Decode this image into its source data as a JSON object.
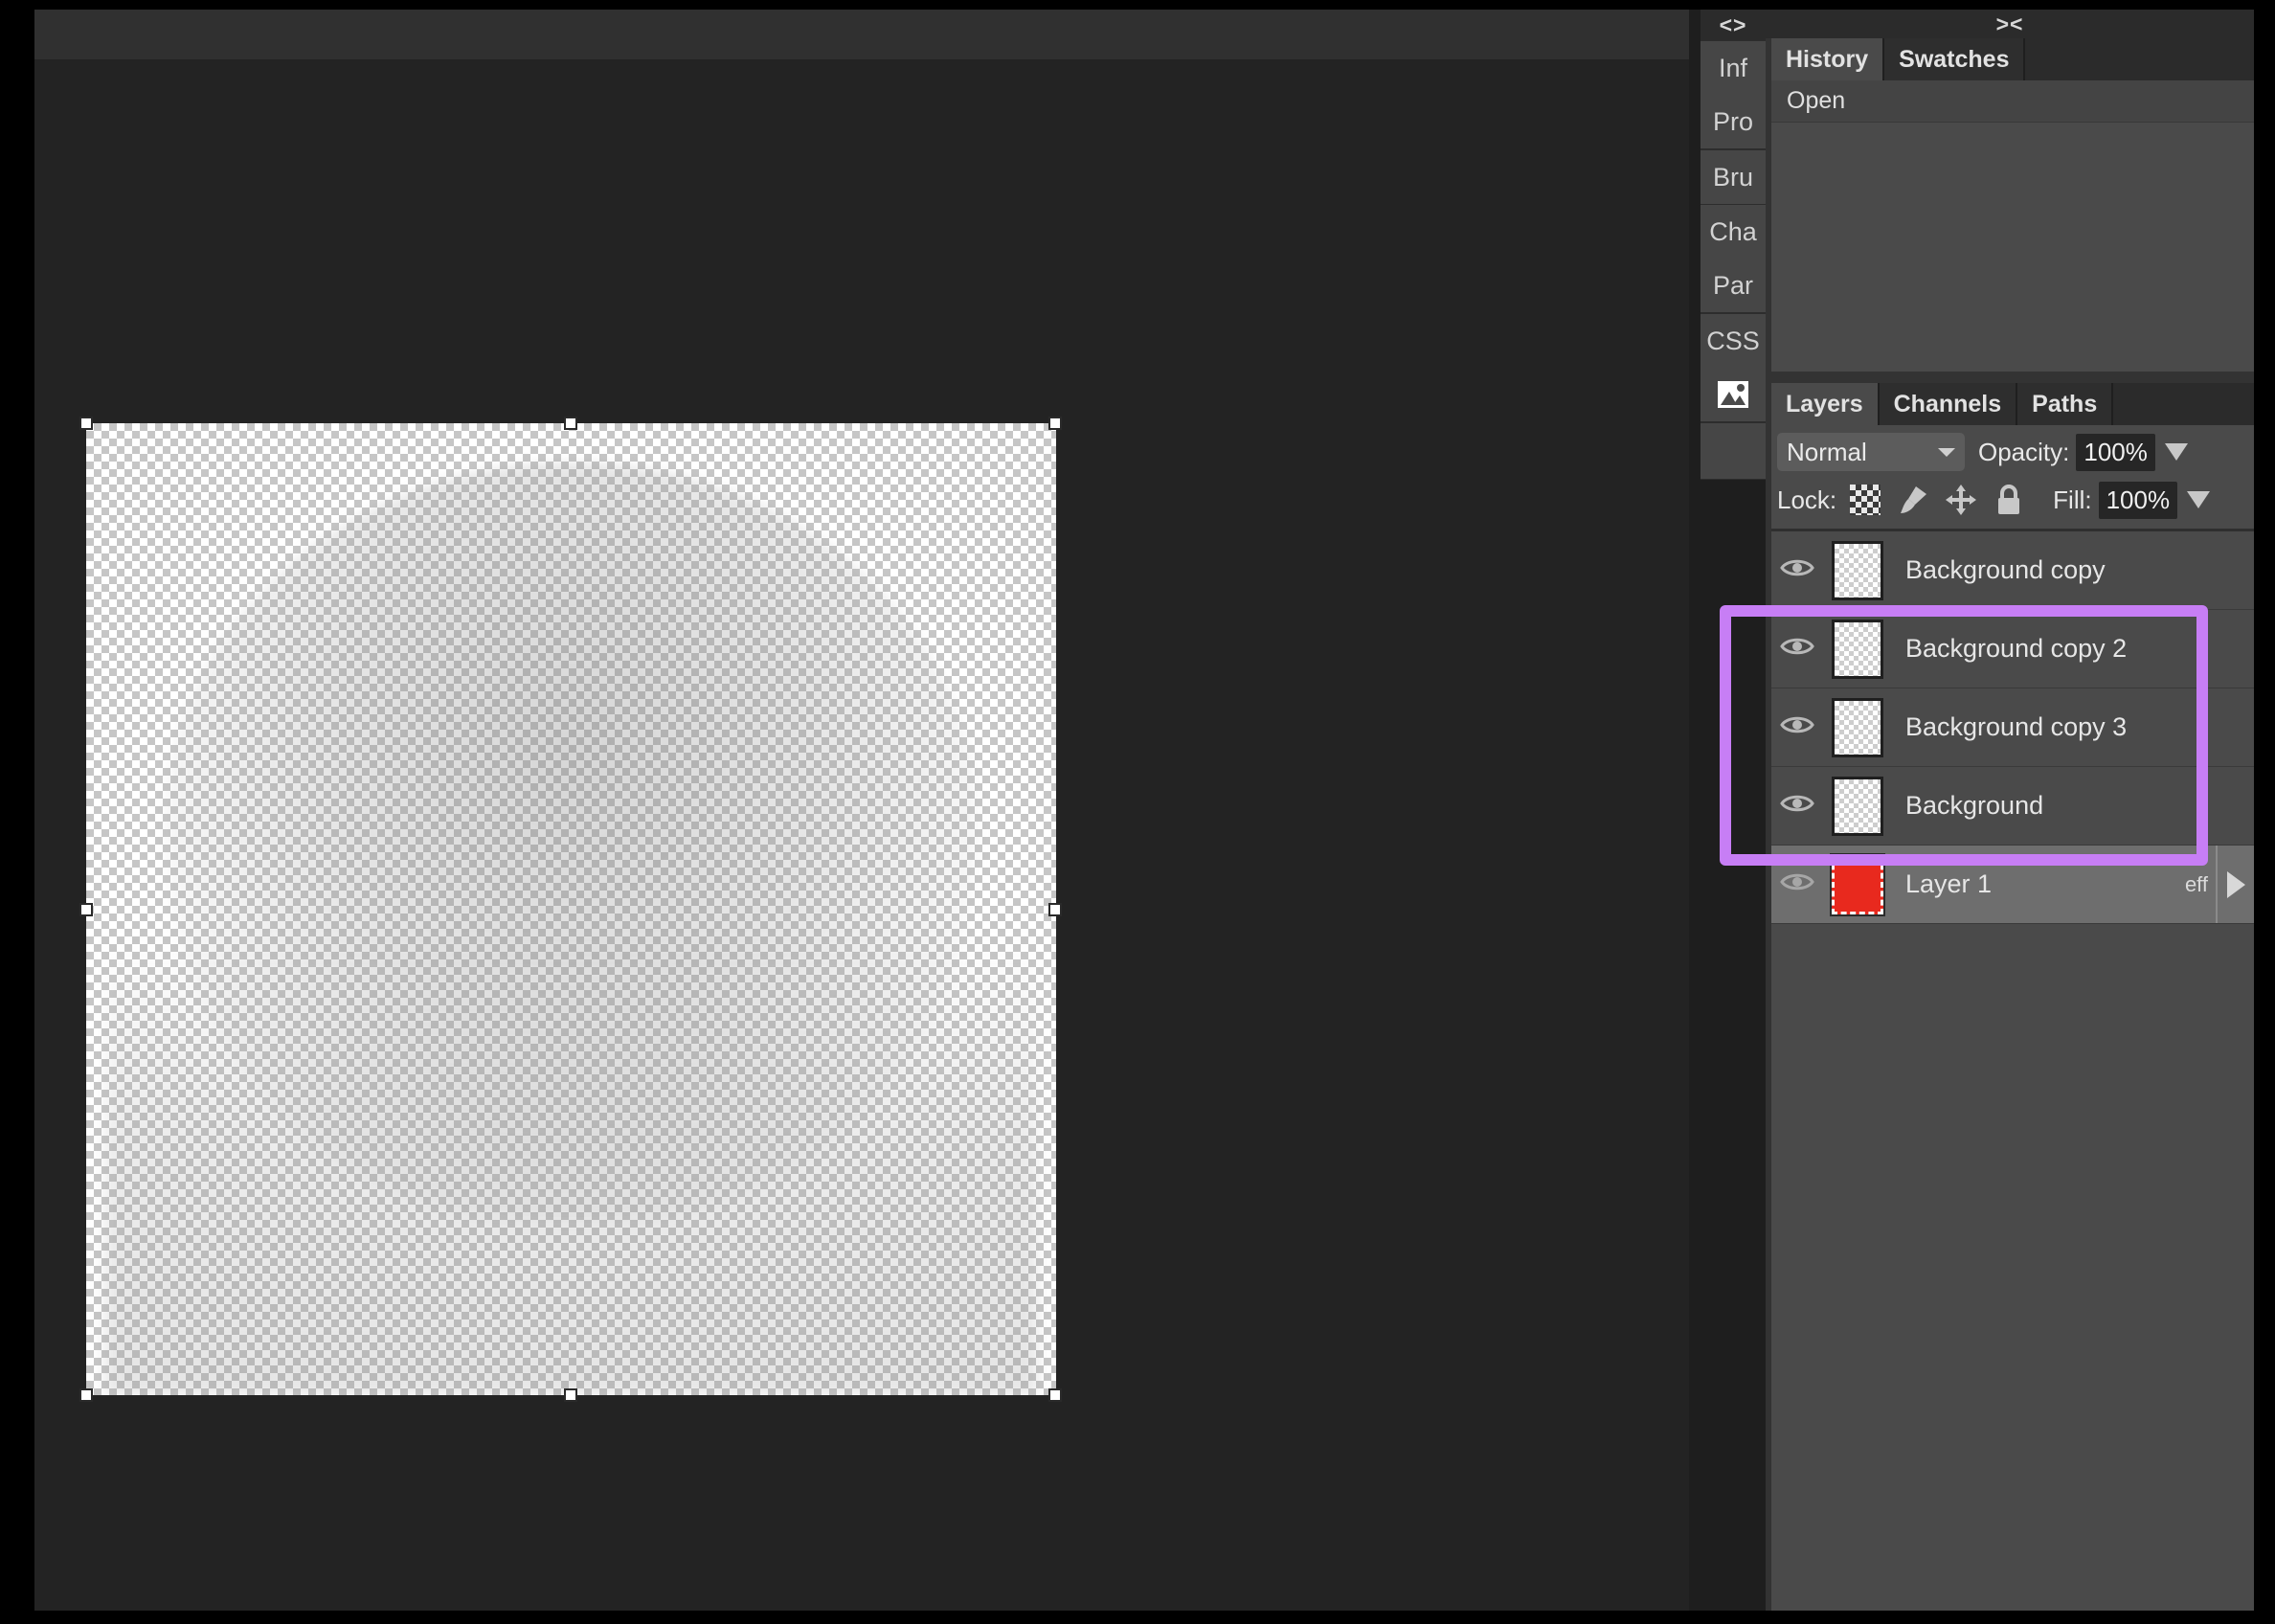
{
  "app": {
    "title": "Photopea Image Editor",
    "canvas_bg": "#232323",
    "panel_bg": "#4a4a4a",
    "accent_highlight": "#c77ef5"
  },
  "rail": {
    "collapse_glyph": "<>",
    "groups": [
      {
        "items": [
          {
            "label": "Inf"
          },
          {
            "label": "Pro"
          }
        ]
      },
      {
        "items": [
          {
            "label": "Bru"
          }
        ]
      },
      {
        "items": [
          {
            "label": "Cha"
          },
          {
            "label": "Par"
          }
        ]
      },
      {
        "items": [
          {
            "label": "CSS"
          },
          {
            "label": "",
            "icon": "image-icon"
          }
        ]
      }
    ]
  },
  "panels": {
    "collapse_glyph": "><",
    "history": {
      "tabs": [
        {
          "label": "History",
          "active": true
        },
        {
          "label": "Swatches",
          "active": false
        }
      ],
      "items": [
        {
          "label": "Open"
        }
      ]
    },
    "layers": {
      "tabs": [
        {
          "label": "Layers",
          "active": true
        },
        {
          "label": "Channels",
          "active": false
        },
        {
          "label": "Paths",
          "active": false
        }
      ],
      "blend_mode": "Normal",
      "opacity_label": "Opacity:",
      "opacity_value": "100%",
      "lock_label": "Lock:",
      "lock_icons": [
        {
          "name": "lock-transparency-icon"
        },
        {
          "name": "lock-brush-icon"
        },
        {
          "name": "lock-move-icon"
        },
        {
          "name": "lock-all-icon"
        }
      ],
      "fill_label": "Fill:",
      "fill_value": "100%",
      "rows": [
        {
          "name": "Background copy",
          "visible": true,
          "selected": false,
          "thumb": "checker",
          "effects": ""
        },
        {
          "name": "Background copy 2",
          "visible": true,
          "selected": false,
          "thumb": "checker",
          "effects": ""
        },
        {
          "name": "Background copy 3",
          "visible": true,
          "selected": false,
          "thumb": "checker",
          "effects": ""
        },
        {
          "name": "Background",
          "visible": true,
          "selected": false,
          "thumb": "checker",
          "effects": ""
        },
        {
          "name": "Layer 1",
          "visible": true,
          "selected": true,
          "thumb": "#e8291e",
          "effects": "eff"
        }
      ]
    }
  },
  "canvas": {
    "transform_active": true,
    "handle_count": 8
  }
}
